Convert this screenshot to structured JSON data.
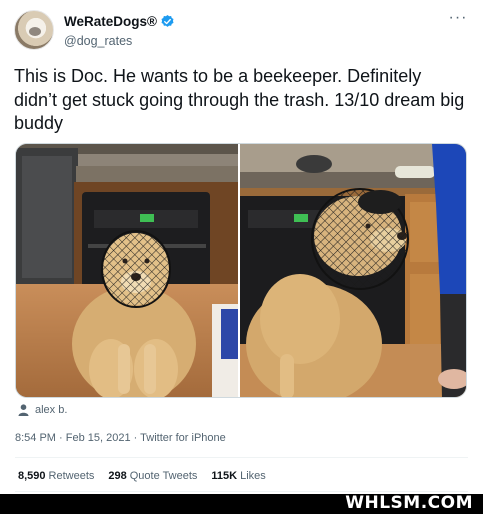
{
  "tweet": {
    "display_name": "WeRateDogs®",
    "handle": "@dog_rates",
    "text": "This is Doc. He wants to be a beekeeper. Definitely didn’t get stuck going through the trash. 13/10 dream big buddy",
    "photo_credit": "alex b.",
    "timestamp": "8:54 PM · Feb 15, 2021 · ",
    "source": "Twitter for iPhone",
    "stats": [
      {
        "count": "8,590",
        "label": "Retweets"
      },
      {
        "count": "298",
        "label": "Quote Tweets"
      },
      {
        "count": "115K",
        "label": "Likes"
      }
    ]
  },
  "watermark": "WHLSM.COM",
  "icons": {
    "verified": "verified-badge-icon",
    "more": "more-options-icon",
    "person": "person-icon"
  },
  "colors": {
    "verified_blue": "#1d9bf0",
    "secondary_text": "#536471",
    "primary_text": "#0f1419"
  }
}
